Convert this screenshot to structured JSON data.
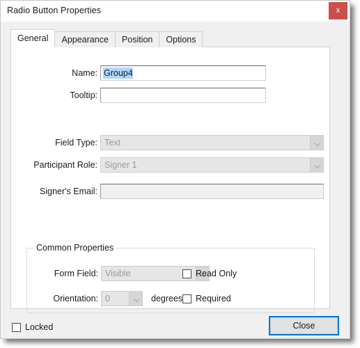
{
  "window": {
    "title": "Radio Button Properties",
    "close_icon": "close-x-icon",
    "close_label": "x"
  },
  "tabs": [
    {
      "label": "General",
      "active": true
    },
    {
      "label": "Appearance",
      "active": false
    },
    {
      "label": "Position",
      "active": false
    },
    {
      "label": "Options",
      "active": false
    }
  ],
  "general": {
    "name": {
      "label": "Name:",
      "value": "Group4",
      "selected": true
    },
    "tooltip": {
      "label": "Tooltip:",
      "value": ""
    },
    "field_type": {
      "label": "Field Type:",
      "value": "Text",
      "disabled": true
    },
    "participant_role": {
      "label": "Participant Role:",
      "value": "Signer 1",
      "disabled": true
    },
    "signers_email": {
      "label": "Signer's Email:",
      "value": "",
      "disabled": true
    }
  },
  "common_properties": {
    "legend": "Common Properties",
    "form_field": {
      "label": "Form Field:",
      "value": "Visible",
      "disabled": true
    },
    "orientation": {
      "label": "Orientation:",
      "value": "0",
      "units": "degrees",
      "disabled": true
    },
    "read_only": {
      "label": "Read Only",
      "checked": false
    },
    "required": {
      "label": "Required",
      "checked": false
    }
  },
  "footer": {
    "locked": {
      "label": "Locked",
      "checked": false
    },
    "close_button": "Close"
  },
  "colors": {
    "titlebar_bg": "#ffffff",
    "dialog_bg": "#f0f0f0",
    "panel_bg": "#ffffff",
    "close_red": "#c9504d",
    "focus_blue": "#0078d7",
    "selection_blue": "#add6ff",
    "disabled_text": "#9a9a9a"
  }
}
